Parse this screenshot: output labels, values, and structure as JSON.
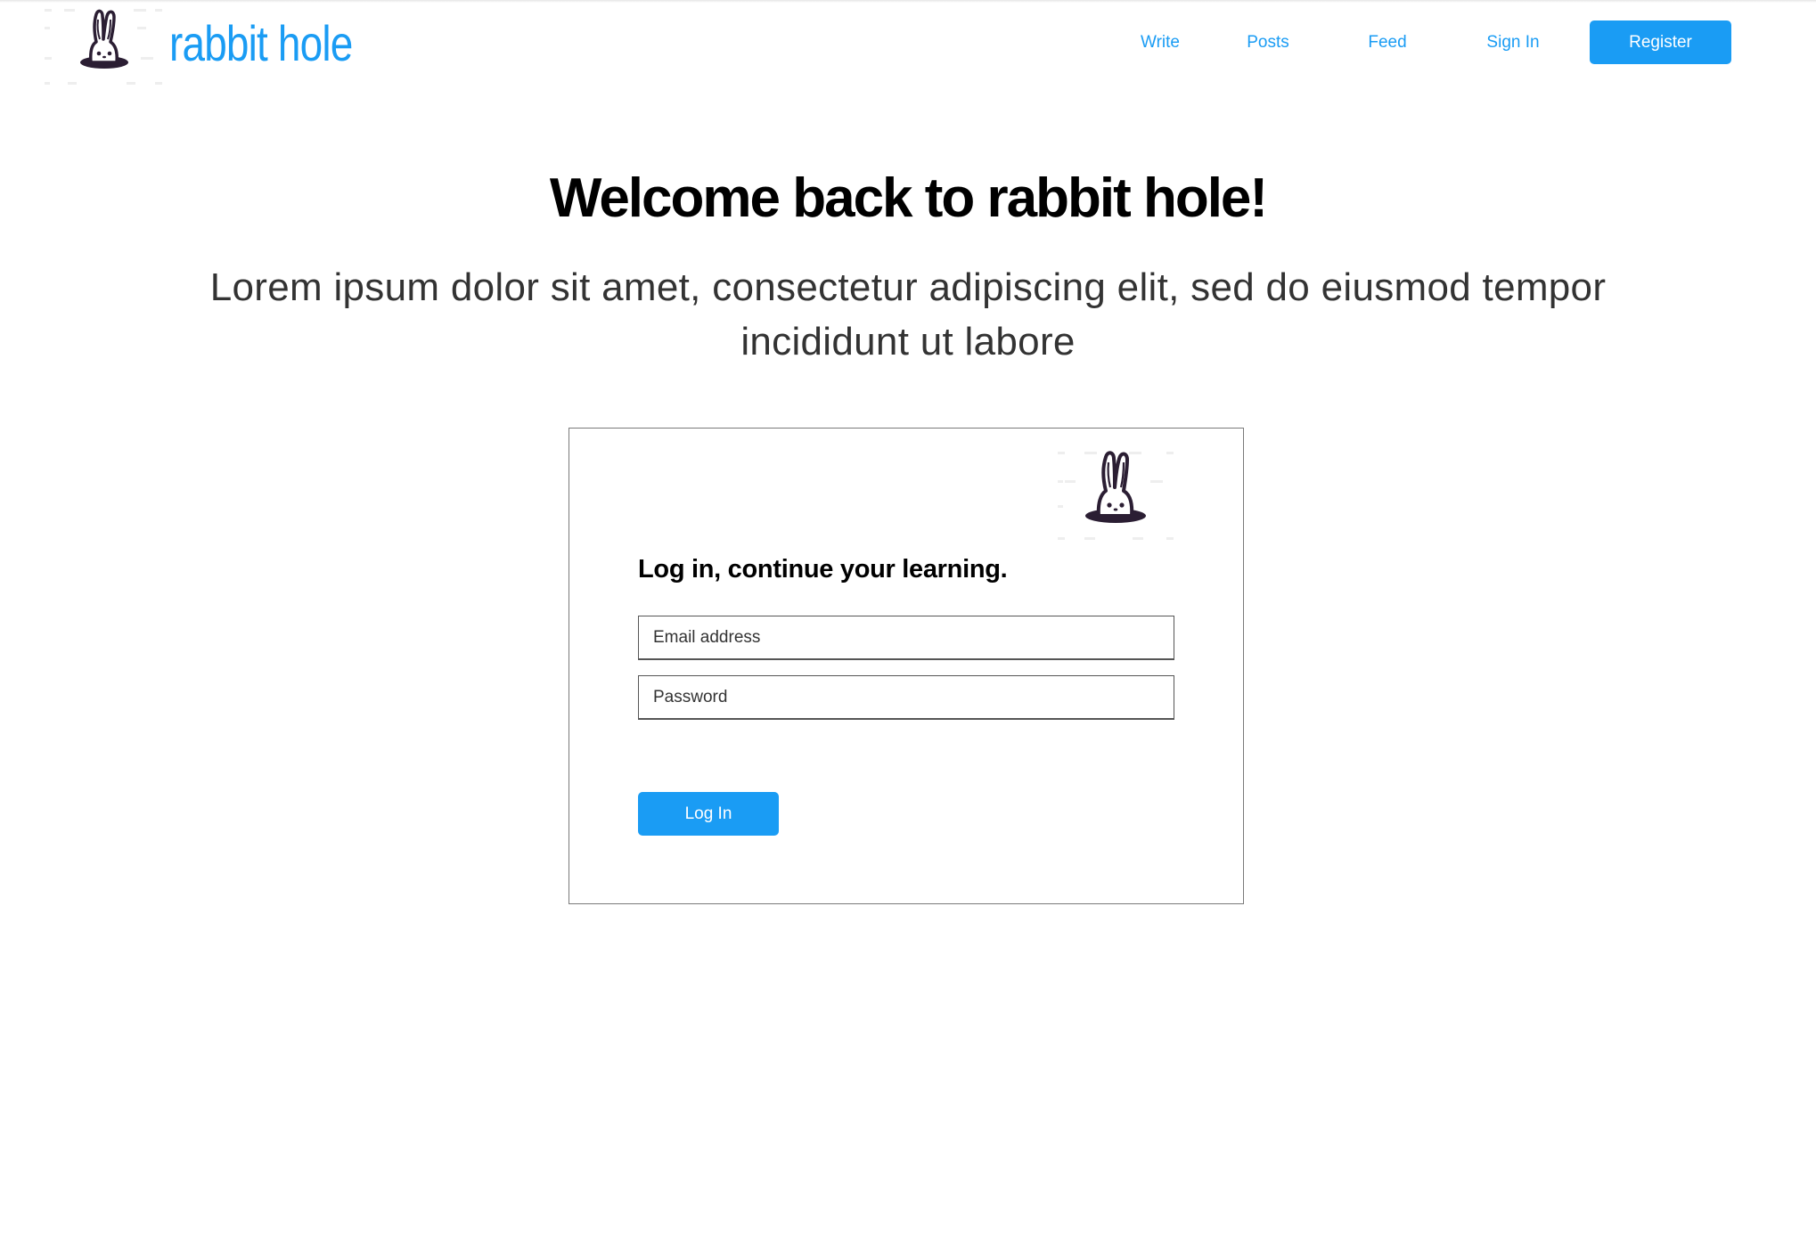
{
  "colors": {
    "accent": "#1a9cf4",
    "title": "#000000",
    "subtitle": "#333333"
  },
  "brand": {
    "name": "rabbit hole",
    "logo_icon": "rabbit-in-hole-icon"
  },
  "nav": {
    "items": [
      {
        "label": "Write"
      },
      {
        "label": "Posts"
      },
      {
        "label": "Feed"
      },
      {
        "label": "Sign In"
      }
    ],
    "register_label": "Register"
  },
  "hero": {
    "title": "Welcome back to rabbit hole!",
    "subtitle": "Lorem ipsum dolor sit amet, consectetur adipiscing elit, sed do eiusmod tempor incididunt ut labore"
  },
  "login": {
    "logo_icon": "rabbit-in-hole-icon",
    "heading": "Log in, continue your learning.",
    "email_placeholder": "Email address",
    "password_placeholder": "Password",
    "submit_label": "Log In"
  }
}
